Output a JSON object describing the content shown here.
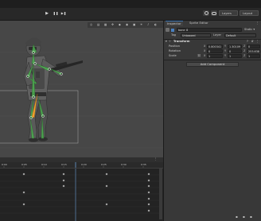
{
  "playback": {
    "play": "▶",
    "pause": "❚❚",
    "step": "▶❚"
  },
  "toolbar": {
    "layers_label": "Layers",
    "layout_label": "Layout"
  },
  "inspector": {
    "tab_inspector": "Inspector",
    "tab_sprite_editor": "Sprite Editor",
    "object_name": "bone_8",
    "static_label": "Static",
    "tag_label": "Tag",
    "tag_value": "Untagged",
    "layer_label": "Layer",
    "layer_value": "Default",
    "component_title": "Transform",
    "position_label": "Position",
    "rotation_label": "Rotation",
    "scale_label": "Scale",
    "position": {
      "x": "0.800341",
      "y": "1.30109",
      "z": "0"
    },
    "rotation": {
      "x": "0",
      "y": "0",
      "z": "253.638"
    },
    "scale": {
      "x": "1",
      "y": "1",
      "z": "1"
    },
    "add_component": "Add Component"
  },
  "animation": {
    "ruler": [
      "0:00",
      "0:05",
      "0:10",
      "0:15",
      "0:20",
      "0:25",
      "0:30",
      "0:35",
      "0:40"
    ]
  },
  "colors": {
    "accent": "#3a72b0",
    "bone": "#4caf50",
    "bone_selected": "#f0a030"
  },
  "icons": [
    "play-icon",
    "pause-icon",
    "step-icon",
    "lock-icon",
    "gear-icon",
    "transform-icon"
  ]
}
